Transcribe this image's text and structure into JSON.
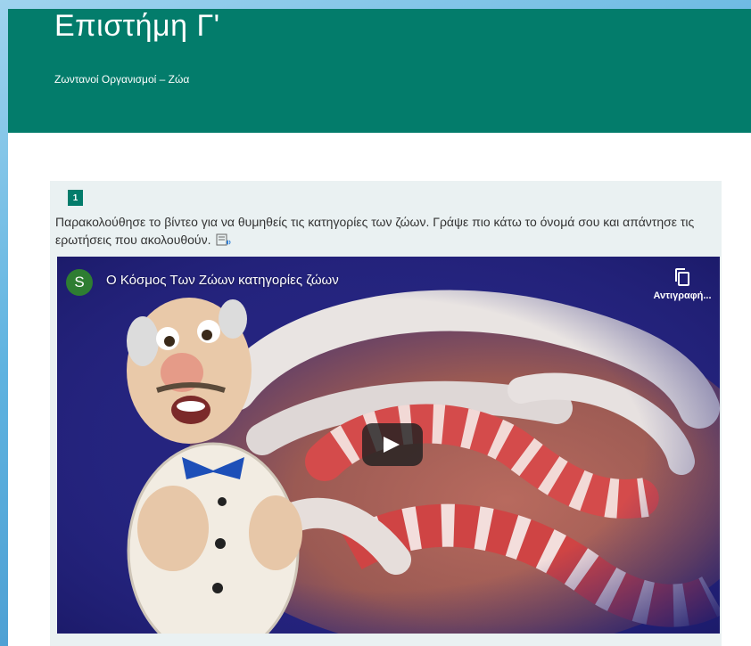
{
  "header": {
    "title": "Επιστήμη Γ'",
    "subtitle": "Ζωντανοί Οργανισμοί – Ζώα",
    "color": "#037c6b"
  },
  "question": {
    "number": "1",
    "text": "Παρακολούθησε το βίντεο για να θυμηθείς τις κατηγορίες των ζώων. Γράψε πιο κάτω το όνομά σου και απάντησε τις ερωτήσεις που ακολουθούν.",
    "reader_icon": "immersive-reader-icon"
  },
  "video": {
    "channel_initial": "S",
    "title": "Ο Κόσμος Των Ζώων κατηγορίες ζώων",
    "copy_label": "Αντιγραφή...",
    "play_icon": "play-icon",
    "copy_icon": "copy-icon"
  }
}
